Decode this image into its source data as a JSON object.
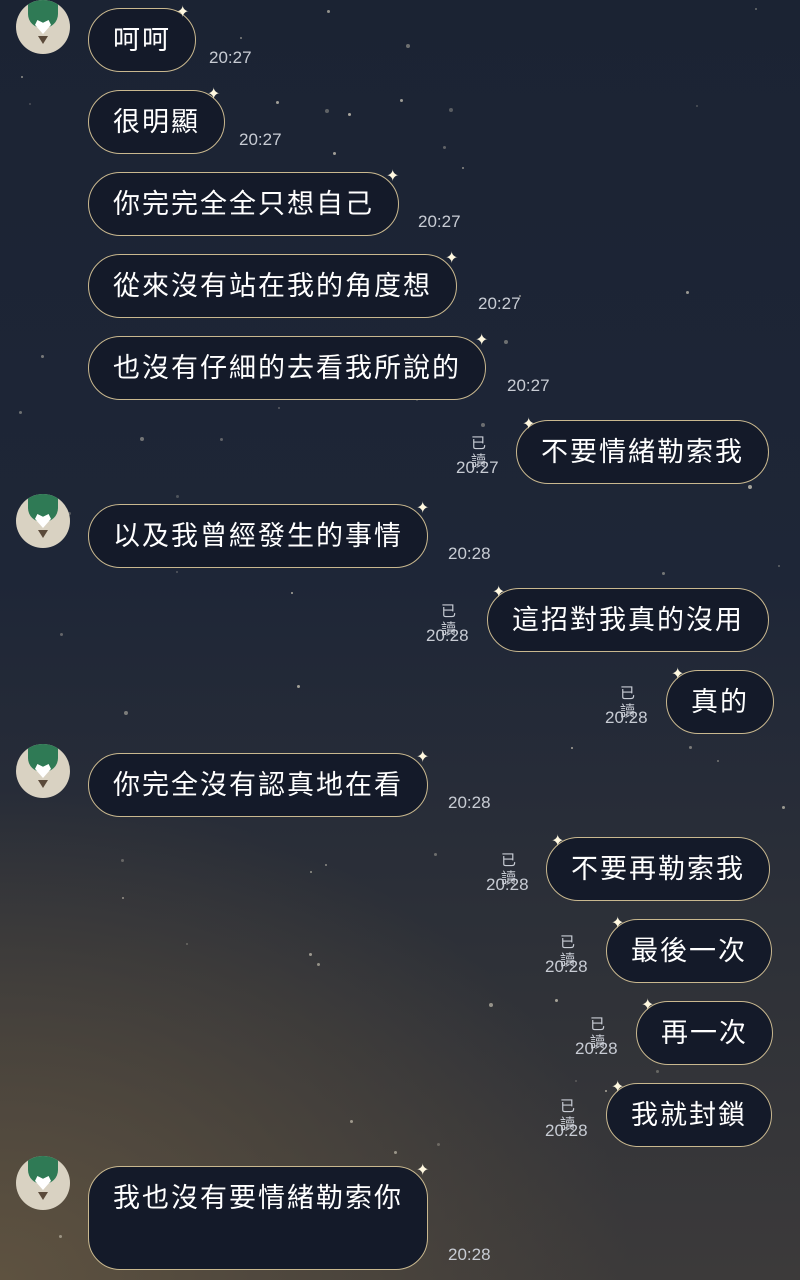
{
  "chat": {
    "messages": [
      {
        "side": "left",
        "avatar": true,
        "text": "呵呵",
        "time": "20:27"
      },
      {
        "side": "left",
        "avatar": false,
        "text": "很明顯",
        "time": "20:27"
      },
      {
        "side": "left",
        "avatar": false,
        "text": "你完完全全只想自己",
        "time": "20:27"
      },
      {
        "side": "left",
        "avatar": false,
        "text": "從來沒有站在我的角度想",
        "time": "20:27"
      },
      {
        "side": "left",
        "avatar": false,
        "text": "也沒有仔細的去看我所說的",
        "time": "20:27"
      },
      {
        "side": "right",
        "text": "不要情緒勒索我",
        "read": "已讀",
        "time": "20:27"
      },
      {
        "side": "left",
        "avatar": true,
        "text": "以及我曾經發生的事情",
        "time": "20:28"
      },
      {
        "side": "right",
        "text": "這招對我真的沒用",
        "read": "已讀",
        "time": "20:28"
      },
      {
        "side": "right",
        "text": "真的",
        "read": "已讀",
        "time": "20:28"
      },
      {
        "side": "left",
        "avatar": true,
        "text": "你完全沒有認真地在看",
        "time": "20:28"
      },
      {
        "side": "right",
        "text": "不要再勒索我",
        "read": "已讀",
        "time": "20:28"
      },
      {
        "side": "right",
        "text": "最後一次",
        "read": "已讀",
        "time": "20:28"
      },
      {
        "side": "right",
        "text": "再一次",
        "read": "已讀",
        "time": "20:28"
      },
      {
        "side": "right",
        "text": "我就封鎖",
        "read": "已讀",
        "time": "20:28"
      },
      {
        "side": "left",
        "avatar": true,
        "text": "我也沒有要情緒勒索你",
        "time": "20:28"
      }
    ]
  },
  "colors": {
    "bubble_bg": "#141a29",
    "bubble_border": "#c9b88f",
    "time_text": "#c8ccd4"
  },
  "icons": {
    "avatar": "green-leaf-heart-avatar",
    "bubble_decoration": "sparkle-icon"
  }
}
